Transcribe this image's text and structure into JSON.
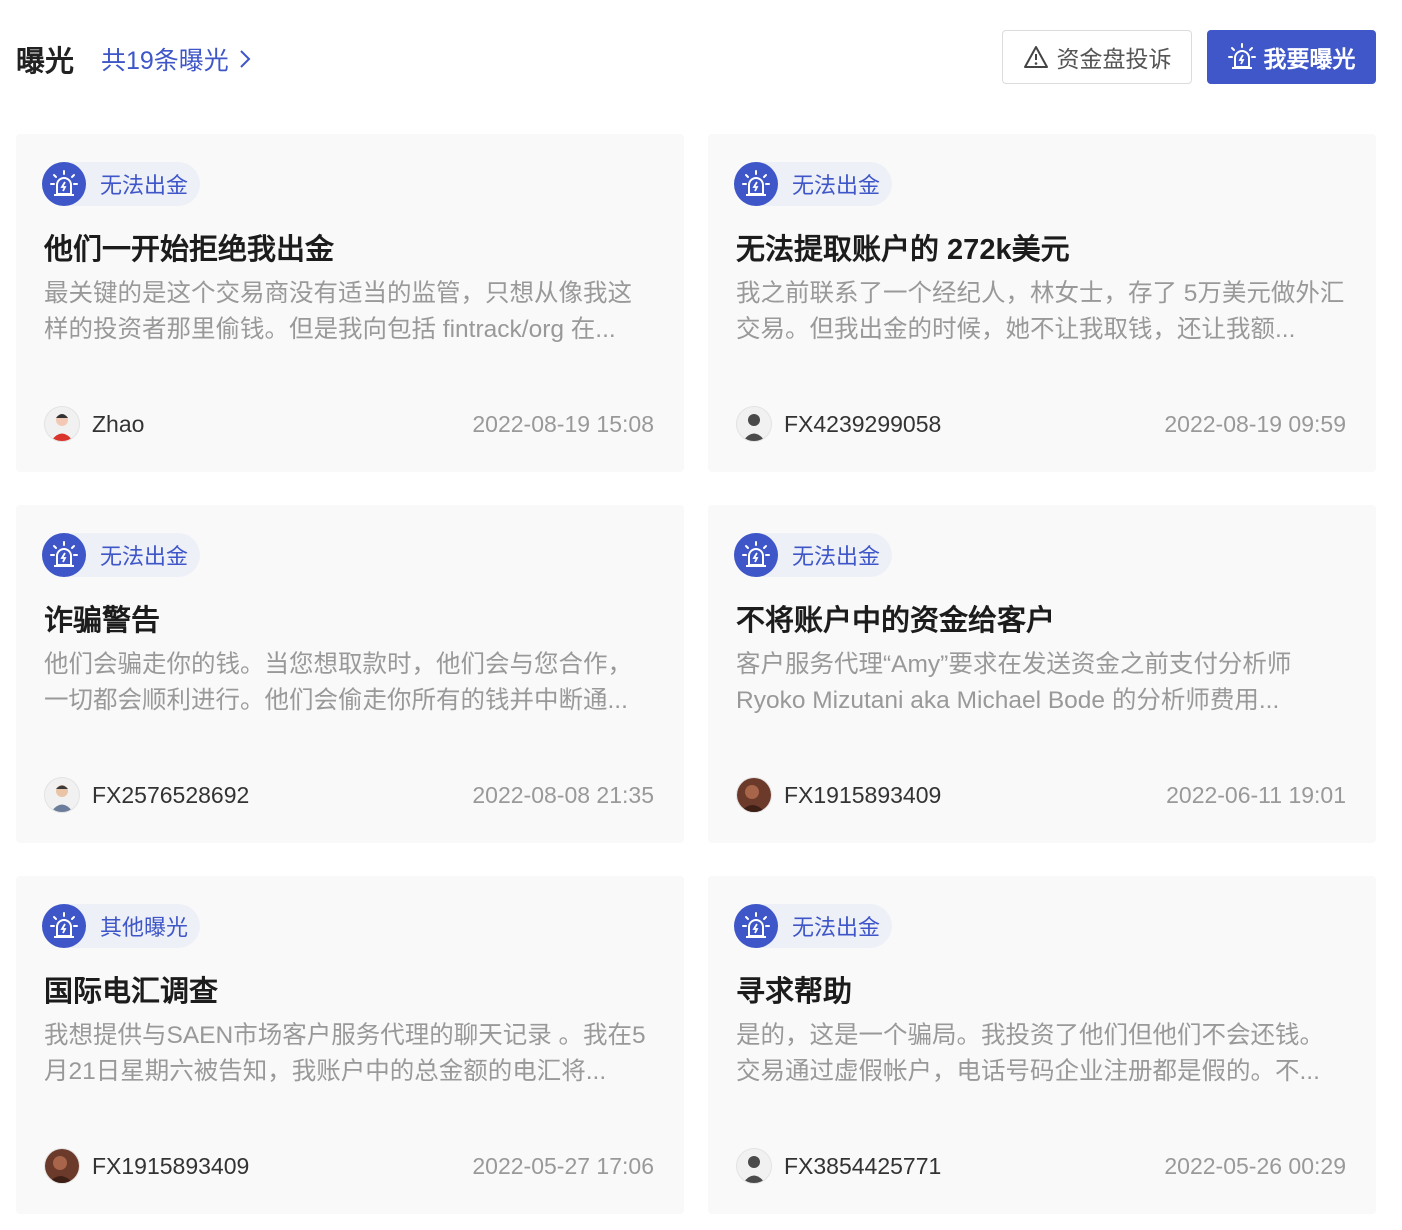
{
  "header": {
    "title": "曝光",
    "count_link": "共19条曝光",
    "complaint_button": "资金盘投诉",
    "expose_button": "我要曝光"
  },
  "cards": [
    {
      "tag": "无法出金",
      "title": "他们一开始拒绝我出金",
      "description": "最关键的是这个交易商没有适当的监管，只想从像我这样的投资者那里偷钱。但是我向包括 fintrack/org 在...",
      "author": "Zhao",
      "avatar": "avatar-red",
      "time": "2022-08-19 15:08"
    },
    {
      "tag": "无法出金",
      "title": "无法提取账户的 272k美元",
      "description": "我之前联系了一个经纪人，林女士，存了 5万美元做外汇交易。但我出金的时候，她不让我取钱，还让我额...",
      "author": "FX4239299058",
      "avatar": "avatar-default",
      "time": "2022-08-19 09:59"
    },
    {
      "tag": "无法出金",
      "title": "诈骗警告",
      "description": "他们会骗走你的钱。当您想取款时，他们会与您合作，一切都会顺利进行。他们会偷走你所有的钱并中断通...",
      "author": "FX2576528692",
      "avatar": "avatar-man",
      "time": "2022-08-08 21:35"
    },
    {
      "tag": "无法出金",
      "title": "不将账户中的资金给客户",
      "description": "客户服务代理“Amy”要求在发送资金之前支付分析师 Ryoko Mizutani aka Michael Bode 的分析师费用...",
      "author": "FX1915893409",
      "avatar": "avatar-photo",
      "time": "2022-06-11 19:01"
    },
    {
      "tag": "其他曝光",
      "title": "国际电汇调查",
      "description": "我想提供与SAEN市场客户服务代理的聊天记录 。我在5月21日星期六被告知，我账户中的总金额的电汇将...",
      "author": "FX1915893409",
      "avatar": "avatar-photo",
      "time": "2022-05-27 17:06"
    },
    {
      "tag": "无法出金",
      "title": "寻求帮助",
      "description": "是的，这是一个骗局。我投资了他们但他们不会还钱。交易通过虚假帐户，电话号码企业注册都是假的。不...",
      "author": "FX3854425771",
      "avatar": "avatar-default",
      "time": "2022-05-26 00:29"
    }
  ],
  "colors": {
    "brand": "#3e56c8",
    "card_bg": "#f9f9fa",
    "muted_text": "#999999"
  }
}
